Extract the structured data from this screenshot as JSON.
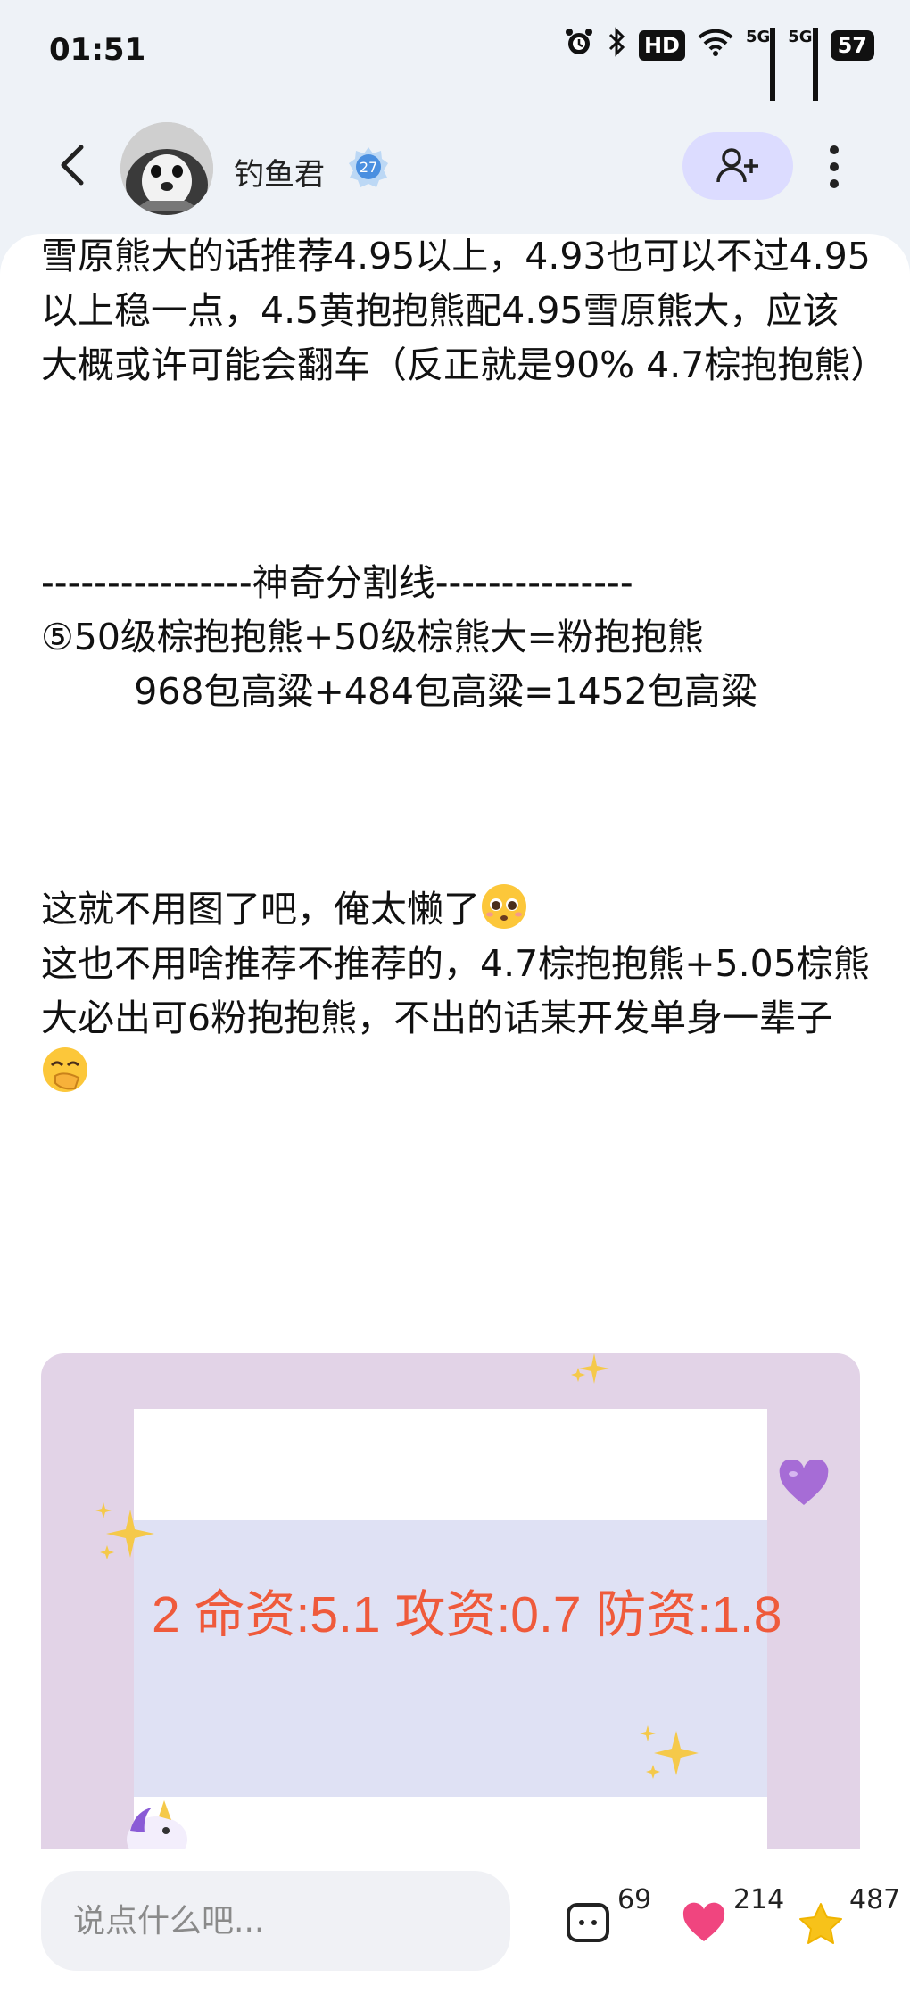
{
  "status_bar": {
    "time": "01:51",
    "icons": [
      "alarm-icon",
      "bluetooth-icon",
      "hd-voice-icon",
      "wifi-icon",
      "5g-signal-icon",
      "5g-signal-icon",
      "battery-icon"
    ],
    "hd_label": "HD",
    "network_1": "5G",
    "network_2": "5G",
    "battery": "57"
  },
  "header": {
    "author_name": "钓鱼君",
    "level": "27",
    "follow_icon": "add-user-icon"
  },
  "article": {
    "paragraphs": [
      " 雪原熊大的话推荐4.95以上，4.93也可以不过4.95以上稳一点，4.5黄抱抱熊配4.95雪原熊大，应该大概或许可能会翻车（反正就是90% 4.7棕抱抱熊）",
      " ----------------神奇分割线---------------",
      " ⑤50级棕抱抱熊+50级棕熊大=粉抱抱熊",
      "        968包高粱+484包高粱=1452包高粱",
      " 这就不用图了吧，俺太懒了",
      " 这也不用啥推荐不推荐的，4.7棕抱抱熊+5.05棕熊大必出可6粉抱抱熊，不出的话某开发单身一辈子 "
    ],
    "image_stats_text": "2 命资:5.1 攻资:0.7 防资:1.8"
  },
  "bottom_bar": {
    "comment_placeholder": "说点什么吧...",
    "comment_count": "69",
    "like_count": "214",
    "favorite_count": "487"
  },
  "colors": {
    "follow_button_bg": "#dcdcff",
    "image_frame": "#e2d3e7",
    "stats_text": "#ef5a3b",
    "like_heart": "#f0457f",
    "favorite_star": "#f7c21a"
  }
}
